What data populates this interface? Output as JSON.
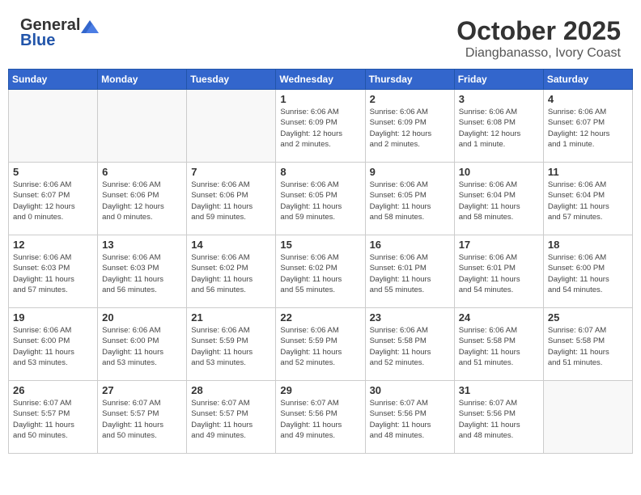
{
  "header": {
    "logo_general": "General",
    "logo_blue": "Blue",
    "month": "October 2025",
    "location": "Diangbanasso, Ivory Coast"
  },
  "weekdays": [
    "Sunday",
    "Monday",
    "Tuesday",
    "Wednesday",
    "Thursday",
    "Friday",
    "Saturday"
  ],
  "weeks": [
    [
      {
        "day": "",
        "info": ""
      },
      {
        "day": "",
        "info": ""
      },
      {
        "day": "",
        "info": ""
      },
      {
        "day": "1",
        "info": "Sunrise: 6:06 AM\nSunset: 6:09 PM\nDaylight: 12 hours\nand 2 minutes."
      },
      {
        "day": "2",
        "info": "Sunrise: 6:06 AM\nSunset: 6:09 PM\nDaylight: 12 hours\nand 2 minutes."
      },
      {
        "day": "3",
        "info": "Sunrise: 6:06 AM\nSunset: 6:08 PM\nDaylight: 12 hours\nand 1 minute."
      },
      {
        "day": "4",
        "info": "Sunrise: 6:06 AM\nSunset: 6:07 PM\nDaylight: 12 hours\nand 1 minute."
      }
    ],
    [
      {
        "day": "5",
        "info": "Sunrise: 6:06 AM\nSunset: 6:07 PM\nDaylight: 12 hours\nand 0 minutes."
      },
      {
        "day": "6",
        "info": "Sunrise: 6:06 AM\nSunset: 6:06 PM\nDaylight: 12 hours\nand 0 minutes."
      },
      {
        "day": "7",
        "info": "Sunrise: 6:06 AM\nSunset: 6:06 PM\nDaylight: 11 hours\nand 59 minutes."
      },
      {
        "day": "8",
        "info": "Sunrise: 6:06 AM\nSunset: 6:05 PM\nDaylight: 11 hours\nand 59 minutes."
      },
      {
        "day": "9",
        "info": "Sunrise: 6:06 AM\nSunset: 6:05 PM\nDaylight: 11 hours\nand 58 minutes."
      },
      {
        "day": "10",
        "info": "Sunrise: 6:06 AM\nSunset: 6:04 PM\nDaylight: 11 hours\nand 58 minutes."
      },
      {
        "day": "11",
        "info": "Sunrise: 6:06 AM\nSunset: 6:04 PM\nDaylight: 11 hours\nand 57 minutes."
      }
    ],
    [
      {
        "day": "12",
        "info": "Sunrise: 6:06 AM\nSunset: 6:03 PM\nDaylight: 11 hours\nand 57 minutes."
      },
      {
        "day": "13",
        "info": "Sunrise: 6:06 AM\nSunset: 6:03 PM\nDaylight: 11 hours\nand 56 minutes."
      },
      {
        "day": "14",
        "info": "Sunrise: 6:06 AM\nSunset: 6:02 PM\nDaylight: 11 hours\nand 56 minutes."
      },
      {
        "day": "15",
        "info": "Sunrise: 6:06 AM\nSunset: 6:02 PM\nDaylight: 11 hours\nand 55 minutes."
      },
      {
        "day": "16",
        "info": "Sunrise: 6:06 AM\nSunset: 6:01 PM\nDaylight: 11 hours\nand 55 minutes."
      },
      {
        "day": "17",
        "info": "Sunrise: 6:06 AM\nSunset: 6:01 PM\nDaylight: 11 hours\nand 54 minutes."
      },
      {
        "day": "18",
        "info": "Sunrise: 6:06 AM\nSunset: 6:00 PM\nDaylight: 11 hours\nand 54 minutes."
      }
    ],
    [
      {
        "day": "19",
        "info": "Sunrise: 6:06 AM\nSunset: 6:00 PM\nDaylight: 11 hours\nand 53 minutes."
      },
      {
        "day": "20",
        "info": "Sunrise: 6:06 AM\nSunset: 6:00 PM\nDaylight: 11 hours\nand 53 minutes."
      },
      {
        "day": "21",
        "info": "Sunrise: 6:06 AM\nSunset: 5:59 PM\nDaylight: 11 hours\nand 53 minutes."
      },
      {
        "day": "22",
        "info": "Sunrise: 6:06 AM\nSunset: 5:59 PM\nDaylight: 11 hours\nand 52 minutes."
      },
      {
        "day": "23",
        "info": "Sunrise: 6:06 AM\nSunset: 5:58 PM\nDaylight: 11 hours\nand 52 minutes."
      },
      {
        "day": "24",
        "info": "Sunrise: 6:06 AM\nSunset: 5:58 PM\nDaylight: 11 hours\nand 51 minutes."
      },
      {
        "day": "25",
        "info": "Sunrise: 6:07 AM\nSunset: 5:58 PM\nDaylight: 11 hours\nand 51 minutes."
      }
    ],
    [
      {
        "day": "26",
        "info": "Sunrise: 6:07 AM\nSunset: 5:57 PM\nDaylight: 11 hours\nand 50 minutes."
      },
      {
        "day": "27",
        "info": "Sunrise: 6:07 AM\nSunset: 5:57 PM\nDaylight: 11 hours\nand 50 minutes."
      },
      {
        "day": "28",
        "info": "Sunrise: 6:07 AM\nSunset: 5:57 PM\nDaylight: 11 hours\nand 49 minutes."
      },
      {
        "day": "29",
        "info": "Sunrise: 6:07 AM\nSunset: 5:56 PM\nDaylight: 11 hours\nand 49 minutes."
      },
      {
        "day": "30",
        "info": "Sunrise: 6:07 AM\nSunset: 5:56 PM\nDaylight: 11 hours\nand 48 minutes."
      },
      {
        "day": "31",
        "info": "Sunrise: 6:07 AM\nSunset: 5:56 PM\nDaylight: 11 hours\nand 48 minutes."
      },
      {
        "day": "",
        "info": ""
      }
    ]
  ]
}
